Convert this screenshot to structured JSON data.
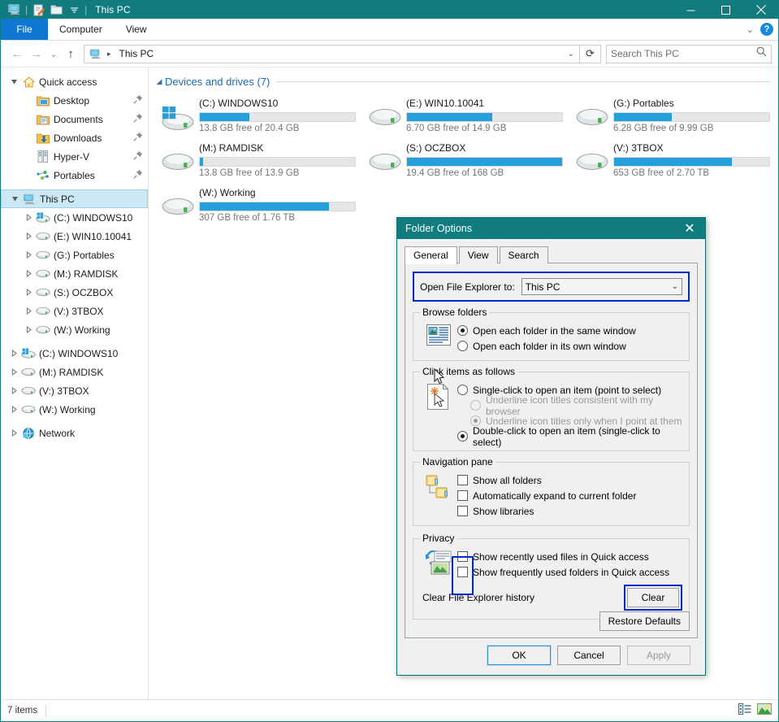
{
  "window": {
    "title": "This PC",
    "quick_access_icons": [
      "this-pc-icon",
      "properties-icon",
      "new-folder-icon",
      "customize-dropdown-icon"
    ],
    "minimize_label": "Minimize",
    "maximize_label": "Maximize",
    "close_label": "Close"
  },
  "ribbon": {
    "tabs": [
      {
        "label": "File",
        "active": true
      },
      {
        "label": "Computer",
        "active": false
      },
      {
        "label": "View",
        "active": false
      }
    ],
    "collapse_label": "⌄",
    "help_label": "?"
  },
  "addressbar": {
    "back_label": "←",
    "forward_label": "→",
    "recent_label": "⌄",
    "up_label": "↑",
    "path_icon": "this-pc-icon",
    "path_text": "This PC",
    "path_separator": "▸",
    "dropdown_label": "⌄",
    "refresh_label": "⟳"
  },
  "search": {
    "placeholder": "Search This PC",
    "icon": "search-icon"
  },
  "sidebar": {
    "items": [
      {
        "label": "Quick access",
        "icon": "quick-access-icon",
        "indent": 0,
        "twisty": "expanded",
        "pinned": false,
        "selected": false
      },
      {
        "label": "Desktop",
        "icon": "desktop-folder-icon",
        "indent": 1,
        "twisty": "none",
        "pinned": true,
        "selected": false
      },
      {
        "label": "Documents",
        "icon": "documents-folder-icon",
        "indent": 1,
        "twisty": "none",
        "pinned": true,
        "selected": false
      },
      {
        "label": "Downloads",
        "icon": "downloads-folder-icon",
        "indent": 1,
        "twisty": "none",
        "pinned": true,
        "selected": false
      },
      {
        "label": "Hyper-V",
        "icon": "server-icon",
        "indent": 1,
        "twisty": "none",
        "pinned": true,
        "selected": false
      },
      {
        "label": "Portables",
        "icon": "network-share-icon",
        "indent": 1,
        "twisty": "none",
        "pinned": true,
        "selected": false
      },
      {
        "label": "This PC",
        "icon": "this-pc-icon",
        "indent": 0,
        "twisty": "expanded",
        "pinned": false,
        "selected": true
      },
      {
        "label": "(C:) WINDOWS10",
        "icon": "windows-drive-icon",
        "indent": 1,
        "twisty": "collapsed",
        "pinned": false,
        "selected": false
      },
      {
        "label": "(E:) WIN10.10041",
        "icon": "drive-icon",
        "indent": 1,
        "twisty": "collapsed",
        "pinned": false,
        "selected": false
      },
      {
        "label": "(G:) Portables",
        "icon": "drive-icon",
        "indent": 1,
        "twisty": "collapsed",
        "pinned": false,
        "selected": false
      },
      {
        "label": "(M:) RAMDISK",
        "icon": "drive-icon",
        "indent": 1,
        "twisty": "collapsed",
        "pinned": false,
        "selected": false
      },
      {
        "label": "(S:) OCZBOX",
        "icon": "drive-icon",
        "indent": 1,
        "twisty": "collapsed",
        "pinned": false,
        "selected": false
      },
      {
        "label": "(V:) 3TBOX",
        "icon": "drive-icon",
        "indent": 1,
        "twisty": "collapsed",
        "pinned": false,
        "selected": false
      },
      {
        "label": "(W:) Working",
        "icon": "drive-icon",
        "indent": 1,
        "twisty": "collapsed",
        "pinned": false,
        "selected": false
      },
      {
        "label": "(C:) WINDOWS10",
        "icon": "windows-drive-icon",
        "indent": 0,
        "twisty": "collapsed",
        "pinned": false,
        "selected": false
      },
      {
        "label": "(M:) RAMDISK",
        "icon": "drive-icon",
        "indent": 0,
        "twisty": "collapsed",
        "pinned": false,
        "selected": false
      },
      {
        "label": "(V:) 3TBOX",
        "icon": "drive-icon",
        "indent": 0,
        "twisty": "collapsed",
        "pinned": false,
        "selected": false
      },
      {
        "label": "(W:) Working",
        "icon": "drive-icon",
        "indent": 0,
        "twisty": "collapsed",
        "pinned": false,
        "selected": false
      },
      {
        "label": "Network",
        "icon": "network-icon",
        "indent": 0,
        "twisty": "collapsed",
        "pinned": false,
        "selected": false
      }
    ]
  },
  "main": {
    "group_title": "Devices and drives (7)",
    "group_arrow": "◢",
    "drives": [
      {
        "name": "(C:) WINDOWS10",
        "sub": "13.8 GB free of 20.4 GB",
        "used_pct": 32,
        "icon": "windows-drive-icon",
        "bar_color": "#26a0da"
      },
      {
        "name": "(E:) WIN10.10041",
        "sub": "6.70 GB free of 14.9 GB",
        "used_pct": 55,
        "icon": "drive-icon",
        "bar_color": "#26a0da"
      },
      {
        "name": "(G:) Portables",
        "sub": "6.28 GB free of 9.99 GB",
        "used_pct": 37,
        "icon": "drive-icon",
        "bar_color": "#26a0da"
      },
      {
        "name": "(M:) RAMDISK",
        "sub": "13.8 GB free of 13.9 GB",
        "used_pct": 2,
        "icon": "drive-icon",
        "bar_color": "#26a0da"
      },
      {
        "name": "(S:) OCZBOX",
        "sub": "19.4 GB free of 168 GB",
        "used_pct": 100,
        "icon": "drive-icon",
        "bar_color": "#26a0da"
      },
      {
        "name": "(V:) 3TBOX",
        "sub": "653 GB free of 2.70 TB",
        "used_pct": 76,
        "icon": "drive-icon",
        "bar_color": "#26a0da"
      },
      {
        "name": "(W:) Working",
        "sub": "307 GB free of 1.76 TB",
        "used_pct": 83,
        "icon": "drive-icon",
        "bar_color": "#26a0da"
      }
    ]
  },
  "statusbar": {
    "item_count": "7 items",
    "details_view_icon": "details-view-icon",
    "thumbnail_view_icon": "large-icons-view-icon"
  },
  "dialog": {
    "title": "Folder Options",
    "close_label": "✕",
    "tabs": [
      {
        "label": "General",
        "active": true
      },
      {
        "label": "View",
        "active": false
      },
      {
        "label": "Search",
        "active": false
      }
    ],
    "open_to": {
      "label": "Open File Explorer to:",
      "value": "This PC",
      "arrow": "⌄",
      "highlighted": true
    },
    "browse_folders": {
      "legend": "Browse folders",
      "icon": "browse-folders-icon",
      "options": [
        {
          "label": "Open each folder in the same window",
          "underline": "me",
          "checked": true,
          "disabled": false
        },
        {
          "label": "Open each folder in its own window",
          "underline": "w",
          "checked": false,
          "disabled": false
        }
      ]
    },
    "click_items": {
      "legend": "Click items as follows",
      "icon": "single-click-icon",
      "options": [
        {
          "label": "Single-click to open an item (point to select)",
          "underline": "S",
          "checked": false,
          "disabled": false,
          "indent": 0
        },
        {
          "label": "Underline icon titles consistent with my browser",
          "underline": "b",
          "checked": false,
          "disabled": true,
          "indent": 1
        },
        {
          "label": "Underline icon titles only when I point at them",
          "underline": "p",
          "checked": true,
          "disabled": true,
          "indent": 1
        },
        {
          "label": "Double-click to open an item (single-click to select)",
          "underline": "D",
          "checked": true,
          "disabled": false,
          "indent": 0
        }
      ]
    },
    "navigation_pane": {
      "legend": "Navigation pane",
      "icon": "folder-tree-icon",
      "options": [
        {
          "label": "Show all folders",
          "underline": "f",
          "checked": false
        },
        {
          "label": "Automatically expand to current folder",
          "underline": "p",
          "checked": false
        },
        {
          "label": "Show libraries",
          "underline": "",
          "checked": false
        }
      ]
    },
    "privacy": {
      "legend": "Privacy",
      "icon": "privacy-history-icon",
      "highlighted": true,
      "checkbox_highlighted": true,
      "options": [
        {
          "label": "Show recently used files in Quick access",
          "checked": false
        },
        {
          "label": "Show frequently used folders in Quick access",
          "checked": false
        }
      ],
      "clear_label": "Clear File Explorer history",
      "clear_button": "Clear",
      "clear_button_highlighted": true
    },
    "restore_defaults": "Restore Defaults",
    "buttons": [
      {
        "label": "OK",
        "style": "default",
        "disabled": false
      },
      {
        "label": "Cancel",
        "style": "normal",
        "disabled": false
      },
      {
        "label": "Apply",
        "style": "normal",
        "disabled": true
      }
    ]
  },
  "colors": {
    "titlebar": "#117b7e",
    "accent_blue": "#0d77d1",
    "highlight_outline": "#0026d0",
    "progress_blue": "#26a0da",
    "link_blue": "#1a6ab0",
    "selection": "#cce8f4"
  }
}
